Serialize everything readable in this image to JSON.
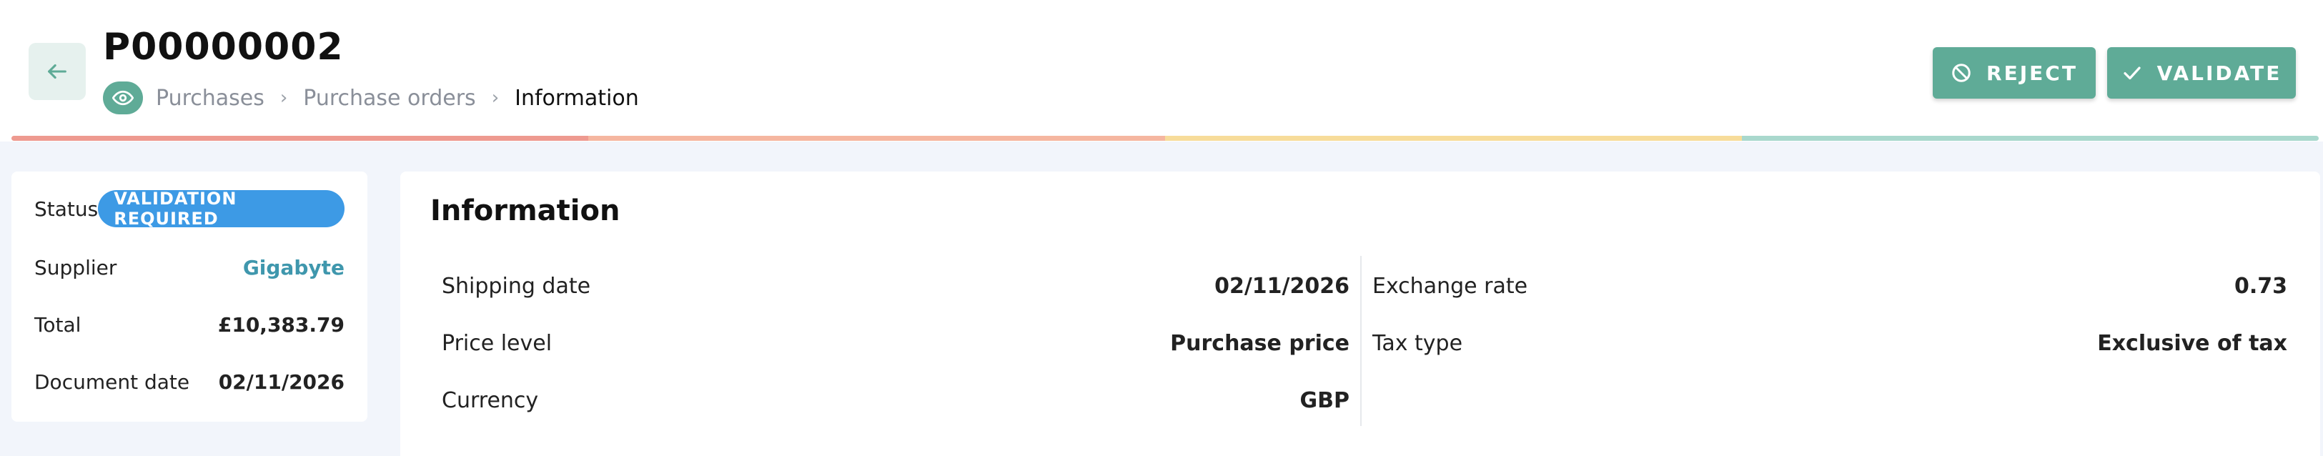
{
  "header": {
    "title": "P00000002",
    "breadcrumb": [
      "Purchases",
      "Purchase orders",
      "Information"
    ],
    "reject_label": "REJECT",
    "validate_label": "VALIDATE"
  },
  "progress_colors": [
    "#ee9a90",
    "#f5b6a0",
    "#f7dc9a",
    "#a9d8cd"
  ],
  "summary": {
    "status_label": "Status",
    "status_value": "VALIDATION REQUIRED",
    "supplier_label": "Supplier",
    "supplier_value": "Gigabyte",
    "total_label": "Total",
    "total_value": "£10,383.79",
    "document_date_label": "Document date",
    "document_date_value": "02/11/2026"
  },
  "information": {
    "title": "Information",
    "left": [
      {
        "label": "Shipping date",
        "value": "02/11/2026"
      },
      {
        "label": "Price level",
        "value": "Purchase price"
      },
      {
        "label": "Currency",
        "value": "GBP"
      }
    ],
    "right": [
      {
        "label": "Exchange rate",
        "value": "0.73"
      },
      {
        "label": "Tax type",
        "value": "Exclusive of tax"
      }
    ]
  },
  "colors": {
    "accent": "#5fab97",
    "badge": "#3d9ae5",
    "link": "#3f97ad"
  },
  "icons": {
    "back": "arrow-left-icon",
    "view": "eye-icon",
    "reject": "ban-icon",
    "validate": "check-icon"
  }
}
